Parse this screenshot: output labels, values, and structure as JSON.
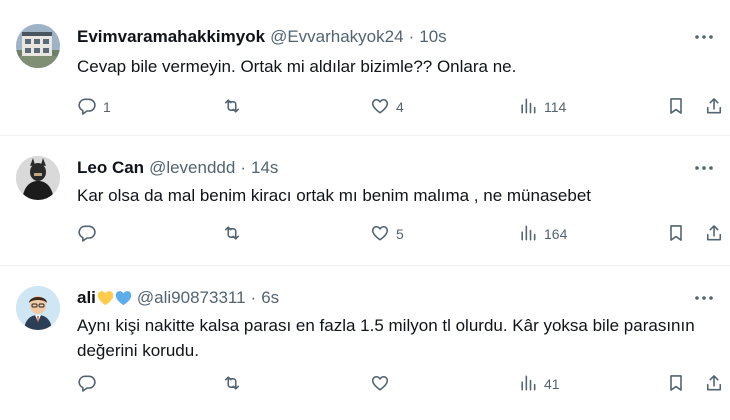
{
  "tweets": [
    {
      "name": "Evimvaramahakkimyok",
      "handle": "@Evvarhakyok24",
      "separator": "·",
      "time": "10s",
      "text": "Cevap bile vermeyin. Ortak mi aldılar bizimle?? Onlara  ne.",
      "replies": "1",
      "retweets": "",
      "likes": "4",
      "views": "114"
    },
    {
      "name": "Leo Can",
      "handle": "@levenddd",
      "separator": "·",
      "time": "14s",
      "text": "Kar olsa da mal benim kiracı ortak mı benim malıma , ne münasebet",
      "replies": "",
      "retweets": "",
      "likes": "5",
      "views": "164"
    },
    {
      "name": "ali",
      "name_emoji": [
        "yellow-heart",
        "blue-heart"
      ],
      "handle": "@ali90873311",
      "separator": "·",
      "time": "6s",
      "text": "Aynı kişi nakitte kalsa parası en fazla 1.5 milyon tl olurdu. Kâr yoksa bile parasının değerini korudu.",
      "replies": "",
      "retweets": "",
      "likes": "",
      "views": "41"
    }
  ],
  "icons": {
    "reply": "reply-icon",
    "retweet": "retweet-icon",
    "like": "heart-icon",
    "views": "views-icon",
    "bookmark": "bookmark-icon",
    "share": "share-icon",
    "more": "more-icon"
  },
  "colors": {
    "text": "#0f1419",
    "secondary": "#536471",
    "divider": "#eff3f4",
    "yellow_heart": "#ffcc4d",
    "blue_heart": "#5dadec"
  }
}
